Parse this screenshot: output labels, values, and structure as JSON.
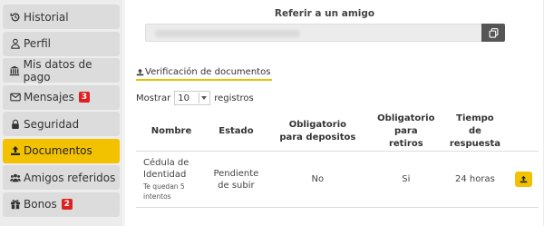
{
  "sidebar": {
    "items": [
      {
        "label": "Historial",
        "icon": "history-icon"
      },
      {
        "label": "Perfil",
        "icon": "user-icon"
      },
      {
        "label": "Mis datos de pago",
        "icon": "bank-icon"
      },
      {
        "label": "Mensajes",
        "icon": "envelope-icon",
        "badge": "3"
      },
      {
        "label": "Seguridad",
        "icon": "lock-icon"
      },
      {
        "label": "Documentos",
        "icon": "upload-icon",
        "active": true
      },
      {
        "label": "Amigos referidos",
        "icon": "users-icon"
      },
      {
        "label": "Bonos",
        "icon": "gift-icon",
        "badge": "2"
      }
    ]
  },
  "referral": {
    "title": "Referir a un amigo",
    "link_value": ""
  },
  "documents": {
    "tab_label": "Verificación de documentos",
    "show_label": "Mostrar",
    "page_size": "10",
    "records_label": "registros",
    "columns": [
      "Nombre",
      "Estado",
      "Obligatorio para depositos",
      "Obligatorio para retiros",
      "Tiempo de respuesta"
    ],
    "rows": [
      {
        "name": "Cédula de Identidad",
        "note": "Te quedan 5 intentos",
        "status": "Pendiente de subir",
        "required_deposits": "No",
        "required_withdrawals": "Si",
        "response_time": "24 horas"
      }
    ]
  },
  "colors": {
    "accent": "#f2c200",
    "badge": "#e02020",
    "copy_button": "#555555"
  }
}
